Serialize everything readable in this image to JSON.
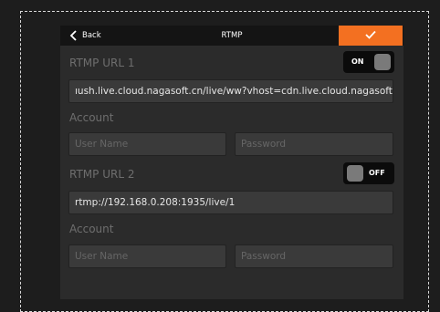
{
  "header": {
    "back_label": "Back",
    "title": "RTMP"
  },
  "stream1": {
    "label": "RTMP URL 1",
    "toggle": "ON",
    "url": "ıush.live.cloud.nagasoft.cn/live/ww?vhost=cdn.live.cloud.nagasoft.cn",
    "account_label": "Account",
    "username_placeholder": "User Name",
    "password_placeholder": "Password"
  },
  "stream2": {
    "label": "RTMP URL 2",
    "toggle": "OFF",
    "url": "rtmp://192.168.0.208:1935/live/1",
    "account_label": "Account",
    "username_placeholder": "User Name",
    "password_placeholder": "Password"
  },
  "icons": {
    "back": "chevron-left-icon",
    "confirm": "check-icon"
  },
  "colors": {
    "accent": "#f37021",
    "background": "#1d1d1d",
    "panel": "#2b2b2b"
  }
}
